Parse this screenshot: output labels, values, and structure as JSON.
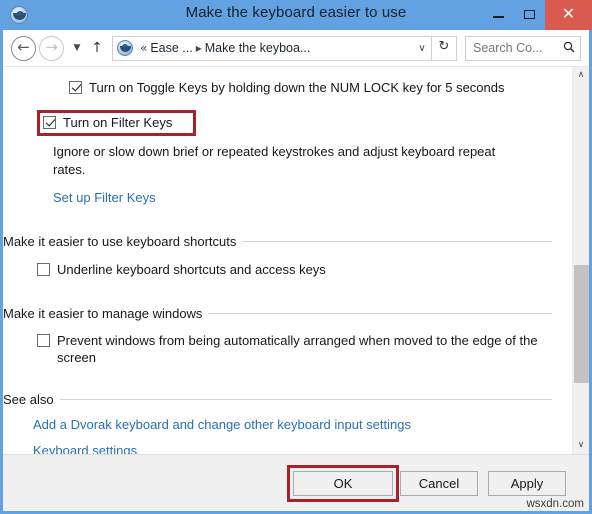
{
  "window": {
    "title": "Make the keyboard easier to use",
    "icon": "ease-of-access-icon",
    "accent_titlebar_color": "#62a2e2",
    "close_button_color": "#d95b50",
    "annotation_color": "#a8222c"
  },
  "window_controls": {
    "minimize": "—",
    "maximize": "☐",
    "close": "✕"
  },
  "navbar": {
    "back": "←",
    "forward": "→",
    "recent_caret": "▼",
    "up": "↑",
    "breadcrumb": {
      "overflow": "«",
      "crumb1": "Ease ...",
      "separator": "▸",
      "crumb2": "Make the keyboa..."
    },
    "address_dropdown": "∨",
    "refresh": "↻",
    "search": {
      "placeholder": "Search Co...",
      "icon": "🔍"
    }
  },
  "content": {
    "toggle_keys": {
      "label": "Turn on Toggle Keys by holding down the NUM LOCK key for 5 seconds",
      "checked": true
    },
    "filter_keys": {
      "label": "Turn on Filter Keys",
      "checked": true,
      "highlighted": true
    },
    "filter_keys_description": "Ignore or slow down brief or repeated keystrokes and adjust keyboard repeat rates.",
    "setup_filter_keys_link": "Set up Filter Keys",
    "shortcuts_section": {
      "heading": "Make it easier to use keyboard shortcuts",
      "underline_shortcuts": {
        "label": "Underline keyboard shortcuts and access keys",
        "checked": false
      }
    },
    "windows_section": {
      "heading": "Make it easier to manage windows",
      "prevent_arrange": {
        "label": "Prevent windows from being automatically arranged when moved to the edge of the screen",
        "checked": false
      }
    },
    "see_also_section": {
      "heading": "See also",
      "link1": "Add a Dvorak keyboard and change other keyboard input settings",
      "link2": "Keyboard settings"
    }
  },
  "scrollbar": {
    "up_arrow": "∧",
    "down_arrow": "∨"
  },
  "footer": {
    "ok": "OK",
    "cancel": "Cancel",
    "apply": "Apply",
    "ok_highlighted": true
  },
  "watermark": "wsxdn.com"
}
